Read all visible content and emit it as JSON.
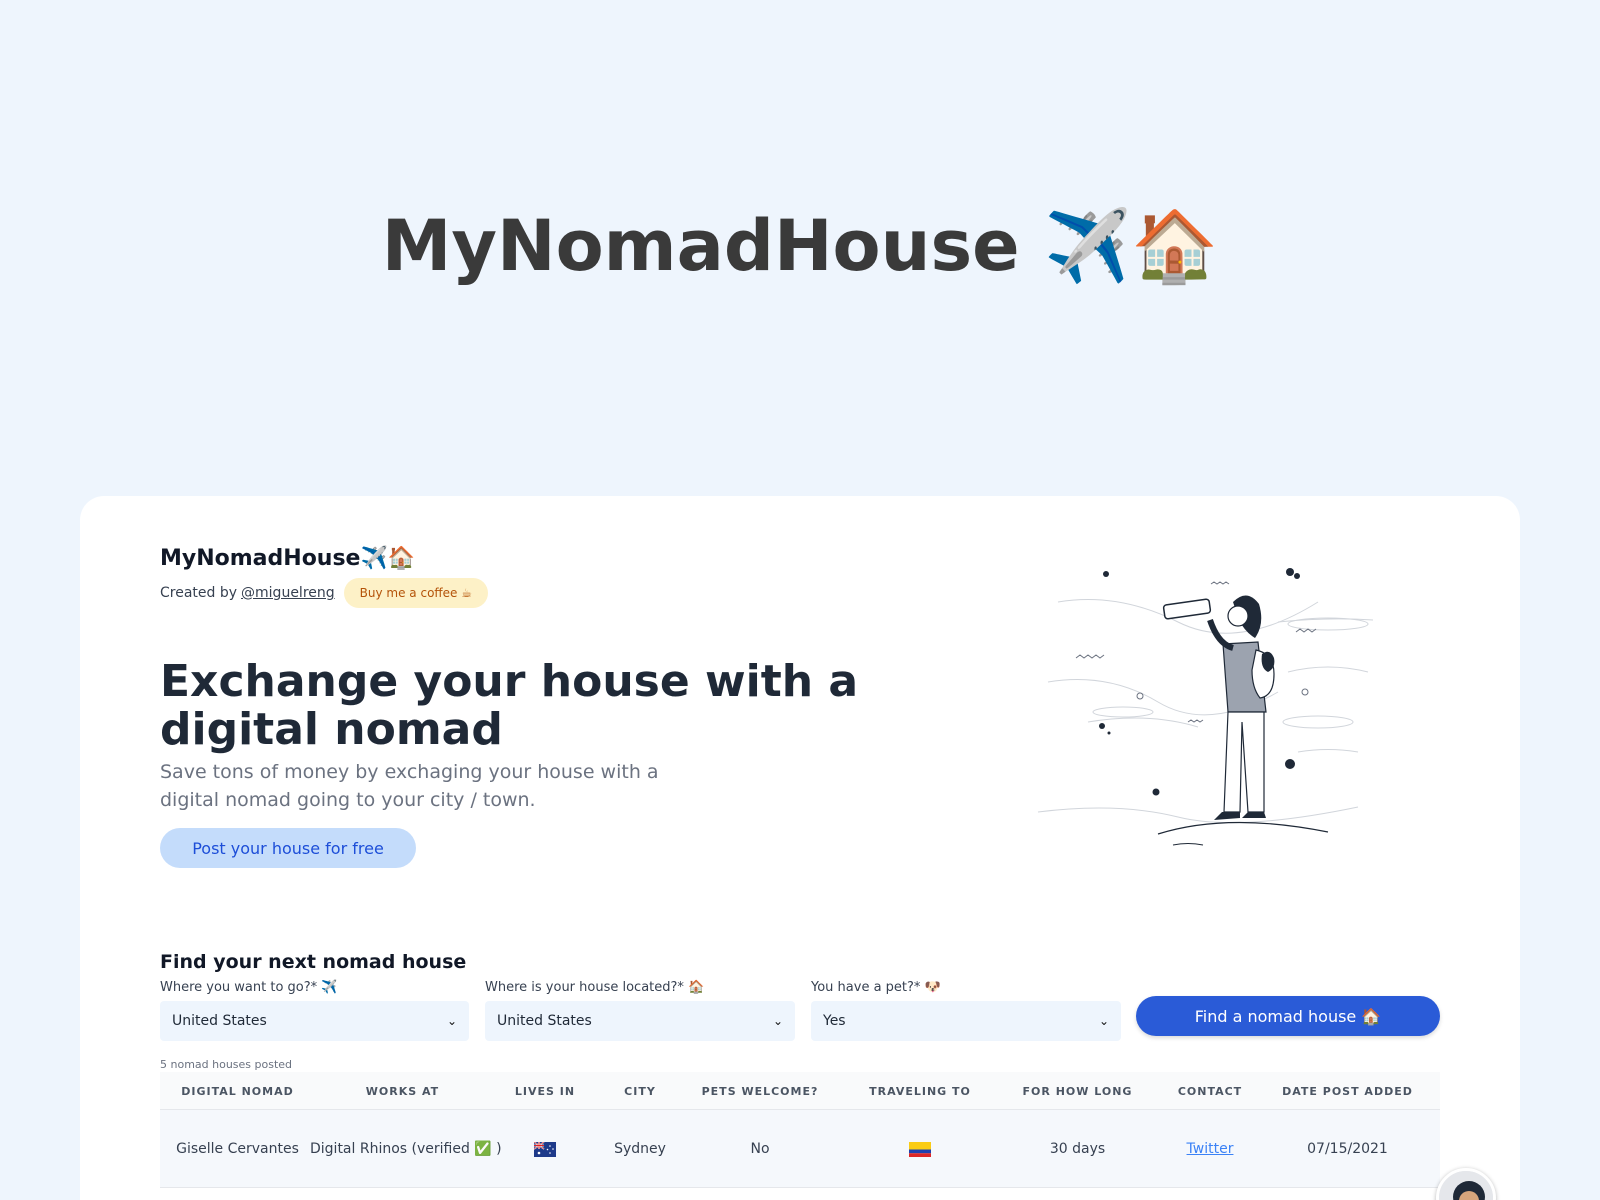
{
  "hero": {
    "title": "MyNomadHouse ✈️🏠"
  },
  "card": {
    "brand": "MyNomadHouse✈️🏠",
    "created_by": "Created by",
    "handle": "@miguelreng",
    "coffee": "Buy me a coffee ☕",
    "headline": "Exchange your house with a digital nomad",
    "subline": "Save tons of money by exchaging your house with a digital nomad going to your city / town.",
    "post_button": "Post your house for free"
  },
  "search": {
    "title": "Find your next nomad house",
    "fields": [
      {
        "label": "Where you want to go?* ✈️",
        "value": "United States"
      },
      {
        "label": "Where is your house located?* 🏠",
        "value": "United States"
      },
      {
        "label": "You have a pet?* 🐶",
        "value": "Yes"
      }
    ],
    "button": "Find a nomad house 🏠",
    "posted_count": "5 nomad houses posted"
  },
  "table": {
    "headers": [
      "DIGITAL NOMAD",
      "WORKS AT",
      "LIVES IN",
      "CITY",
      "PETS WELCOME?",
      "TRAVELING TO",
      "FOR HOW LONG",
      "CONTACT",
      "DATE POST ADDED"
    ],
    "rows": [
      {
        "nomad": "Giselle Cervantes",
        "works_at": "Digital Rhinos (verified ✅ )",
        "lives_in_flag": "australia-flag-icon",
        "city": "Sydney",
        "pets": "No",
        "traveling_to_flag": "colombia-flag-icon",
        "duration": "30 days",
        "contact": "Twitter",
        "date": "07/15/2021"
      }
    ]
  },
  "colors": {
    "page_bg": "#eef5fd",
    "accent": "#2a5bd7",
    "post_button_bg": "#c4dcfb",
    "coffee_bg": "#fdf1c7"
  }
}
